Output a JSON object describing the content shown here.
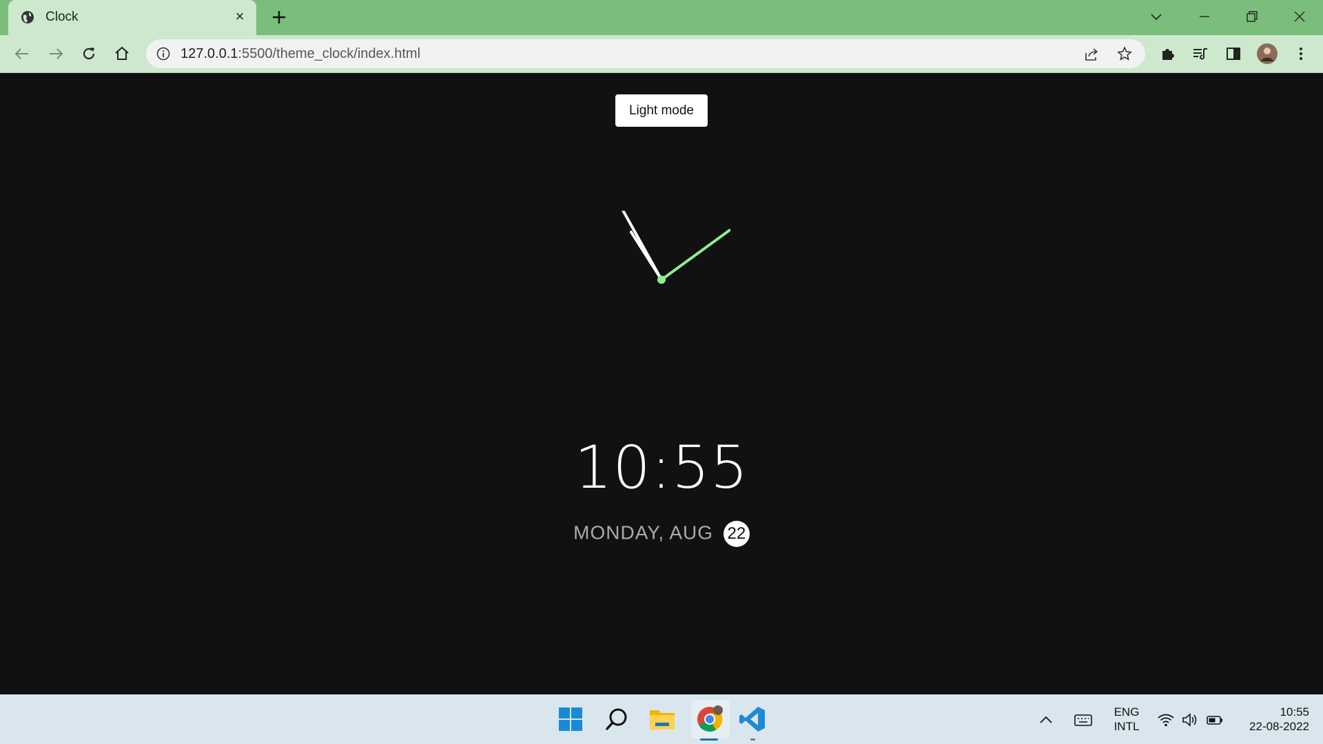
{
  "browser": {
    "tab_title": "Clock",
    "url_host": "127.0.0.1",
    "url_rest": ":5500/theme_clock/index.html",
    "theme_color": "#7bbd7b"
  },
  "page": {
    "toggle_label": "Light mode",
    "time": "10:55",
    "date_prefix": "MONDAY, AUG",
    "date_day": "22",
    "clock": {
      "hour": 10,
      "minute": 55,
      "second": 9,
      "second_hand_color": "#90ee90"
    }
  },
  "taskbar": {
    "lang_primary": "ENG",
    "lang_secondary": "INTL",
    "tray_time": "10:55",
    "tray_date": "22-08-2022",
    "apps": [
      "start-icon",
      "search-icon",
      "file-explorer-icon",
      "chrome-icon",
      "vscode-icon"
    ]
  }
}
